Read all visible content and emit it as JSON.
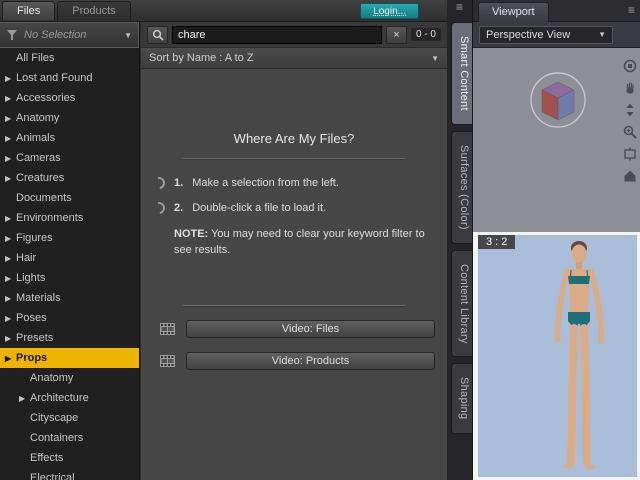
{
  "colors": {
    "highlight": "#edb301",
    "login_teal": "#1b8e96",
    "viewport_gray": "#8e8e96",
    "render_blue": "#a9bdd8"
  },
  "icons": {
    "dropdown": "▼",
    "expand": "▶",
    "clear": "×",
    "menu": "≡",
    "search": "magnifier-icon",
    "filter": "funnel-icon",
    "film": "film-strip-icon"
  },
  "top": {
    "tabs": [
      {
        "label": "Files",
        "active": true
      },
      {
        "label": "Products"
      }
    ],
    "login_label": "Login..."
  },
  "sidebar": {
    "filter_value": "No Selection",
    "items": [
      {
        "label": "All Files"
      },
      {
        "label": "Lost and Found",
        "arrow": true
      },
      {
        "label": "Accessories",
        "arrow": true
      },
      {
        "label": "Anatomy",
        "arrow": true
      },
      {
        "label": "Animals",
        "arrow": true
      },
      {
        "label": "Cameras",
        "arrow": true
      },
      {
        "label": "Creatures",
        "arrow": true
      },
      {
        "label": "Documents"
      },
      {
        "label": "Environments",
        "arrow": true
      },
      {
        "label": "Figures",
        "arrow": true
      },
      {
        "label": "Hair",
        "arrow": true
      },
      {
        "label": "Lights",
        "arrow": true
      },
      {
        "label": "Materials",
        "arrow": true
      },
      {
        "label": "Poses",
        "arrow": true
      },
      {
        "label": "Presets",
        "arrow": true
      },
      {
        "label": "Props",
        "arrow": true,
        "selected": true
      },
      {
        "label": "Anatomy",
        "indent": 1
      },
      {
        "label": "Architecture",
        "arrow": true,
        "indent": 1
      },
      {
        "label": "Cityscape",
        "indent": 1
      },
      {
        "label": "Containers",
        "indent": 1
      },
      {
        "label": "Effects",
        "indent": 1
      },
      {
        "label": "Electrical",
        "indent": 1
      }
    ]
  },
  "content": {
    "search_value": "chare",
    "result_count": "0 - 0",
    "sort_label": "Sort by Name : A to Z",
    "title": "Where Are My Files?",
    "steps": [
      {
        "num": "1.",
        "text": "Make a selection from the left."
      },
      {
        "num": "2.",
        "text": "Double-click a file to load it."
      }
    ],
    "note_label": "NOTE:",
    "note_text": "You may need to clear your keyword filter to see results.",
    "videos": [
      {
        "label": "Video: Files"
      },
      {
        "label": "Video:  Products"
      }
    ]
  },
  "side_tabs": [
    {
      "label": "Smart Content",
      "active": true
    },
    {
      "label": "Surfaces (Color)"
    },
    {
      "label": "Content Library"
    },
    {
      "label": "Shaping"
    }
  ],
  "viewport": {
    "title": "Viewport",
    "view_selector": "Perspective View",
    "aspect_label": "3 : 2",
    "tools": [
      "rotate-tool",
      "pan-tool",
      "dolly-tool",
      "zoom-tool",
      "frame-tool",
      "home-tool"
    ]
  }
}
